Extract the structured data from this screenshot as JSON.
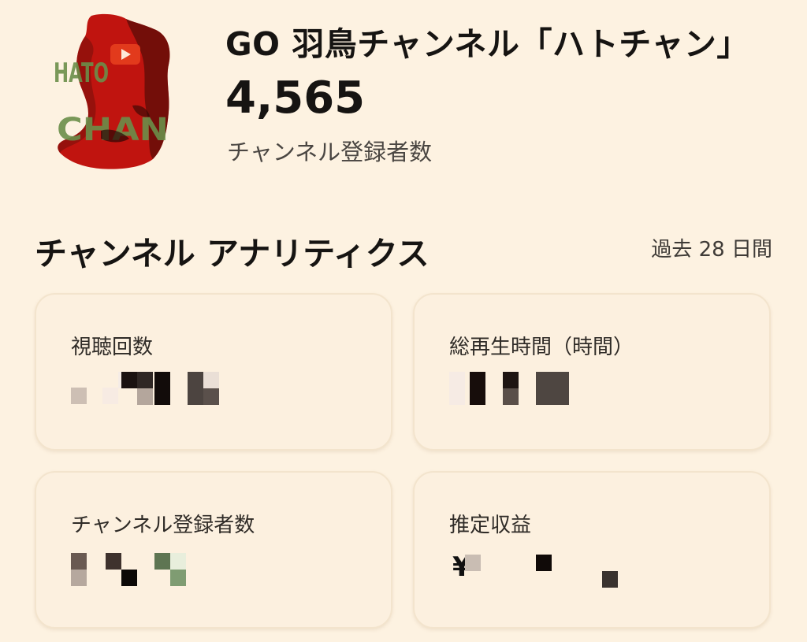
{
  "channel": {
    "name": "GO 羽鳥チャンネル「ハトチャン」",
    "subscriber_count": "4,565",
    "subscriber_label": "チャンネル登録者数",
    "avatar_icon": "channel-avatar-logo",
    "avatar_text_top": "HATO",
    "avatar_text_bottom": "CHAN"
  },
  "analytics": {
    "title": "チャンネル アナリティクス",
    "period": "過去 28 日間",
    "cards": [
      {
        "label": "視聴回数",
        "value": ""
      },
      {
        "label": "総再生時間（時間）",
        "value": ""
      },
      {
        "label": "チャンネル登録者数",
        "value": ""
      },
      {
        "label": "推定収益",
        "value": "",
        "currency_symbol": "¥"
      }
    ]
  },
  "colors": {
    "background": "#fdf2e1",
    "card_background": "#fcf0df",
    "avatar_red": "#c0140f",
    "avatar_dark": "#3a0a06",
    "avatar_green": "#6b8f4a"
  }
}
